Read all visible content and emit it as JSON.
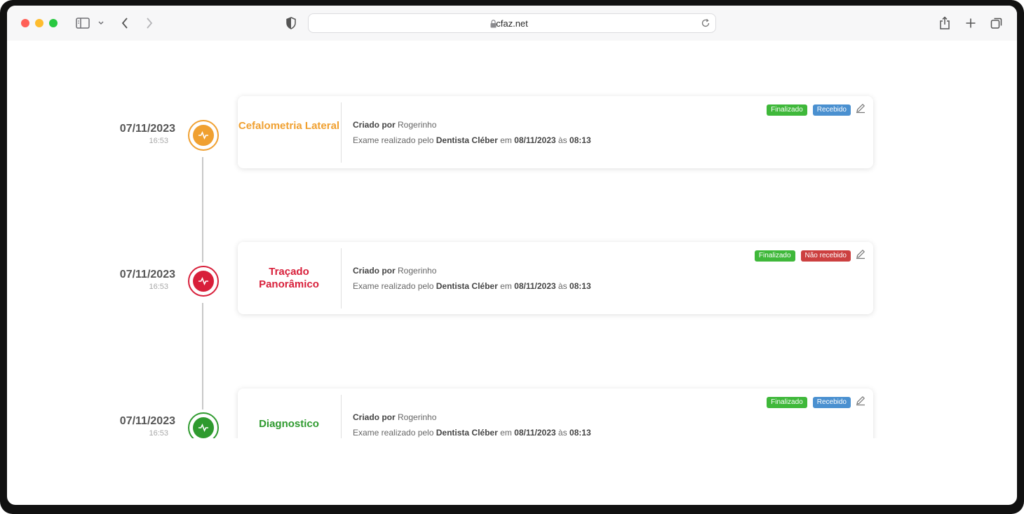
{
  "browser": {
    "url": "cfaz.net"
  },
  "entries": [
    {
      "date": "07/11/2023",
      "time": "16:53",
      "title": "Cefalometria Lateral",
      "color": "#f0a030",
      "created_prefix": "Criado por",
      "created_by": "Rogerinho",
      "exam_prefix": "Exame realizado pelo",
      "exam_by": "Dentista Cléber",
      "exam_mid": "em",
      "exam_date": "08/11/2023",
      "exam_at": "às",
      "exam_time": "08:13",
      "badges": [
        {
          "label": "Finalizado",
          "color": "#3fb83a"
        },
        {
          "label": "Recebido",
          "color": "#4a90d0"
        }
      ]
    },
    {
      "date": "07/11/2023",
      "time": "16:53",
      "title": "Traçado Panorâmico",
      "color": "#d81f3a",
      "created_prefix": "Criado por",
      "created_by": "Rogerinho",
      "exam_prefix": "Exame realizado pelo",
      "exam_by": "Dentista Cléber",
      "exam_mid": "em",
      "exam_date": "08/11/2023",
      "exam_at": "às",
      "exam_time": "08:13",
      "badges": [
        {
          "label": "Finalizado",
          "color": "#3fb83a"
        },
        {
          "label": "Não recebido",
          "color": "#cc4040"
        }
      ]
    },
    {
      "date": "07/11/2023",
      "time": "16:53",
      "title": "Diagnostico",
      "color": "#2e9a2e",
      "created_prefix": "Criado por",
      "created_by": "Rogerinho",
      "exam_prefix": "Exame realizado pelo",
      "exam_by": "Dentista Cléber",
      "exam_mid": "em",
      "exam_date": "08/11/2023",
      "exam_at": "às",
      "exam_time": "08:13",
      "badges": [
        {
          "label": "Finalizado",
          "color": "#3fb83a"
        },
        {
          "label": "Recebido",
          "color": "#4a90d0"
        }
      ]
    }
  ]
}
